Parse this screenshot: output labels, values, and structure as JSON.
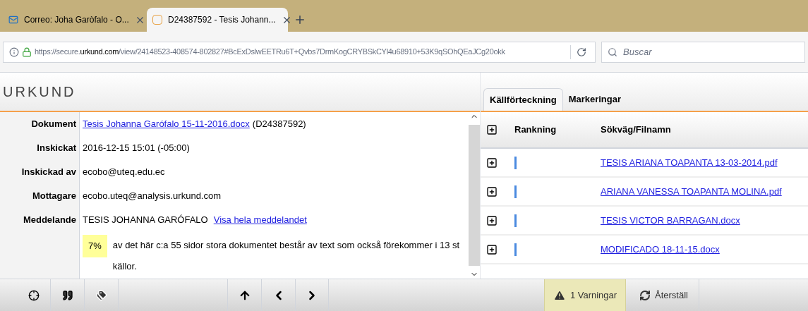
{
  "browser_tabs": [
    {
      "title": "Correo: Joha Garòfalo - O...",
      "selected": false,
      "kind": "mail"
    },
    {
      "title": "D24387592 - Tesis Johann...",
      "selected": true,
      "kind": "urkund"
    }
  ],
  "address_bar": {
    "url_prefix": "https://secure.",
    "url_domain": "urkund.com",
    "url_rest": "/view/24148523-408574-802827#BcExDslwEETRu6T+Qvbs7DrmKogCRYBSkCYl4u68910+53K9qSOhQEaJCg20okk"
  },
  "search": {
    "placeholder": "Buscar"
  },
  "logo": "URKUND",
  "details": [
    {
      "label": "Dokument",
      "link": "Tesis Johanna Garófalo 15-11-2016.docx",
      "value": "(D24387592)"
    },
    {
      "label": "Inskickat",
      "value": "2016-12-15 15:01 (-05:00)"
    },
    {
      "label": "Inskickad av",
      "value": "ecobo@uteq.edu.ec"
    },
    {
      "label": "Mottagare",
      "value": "ecobo.uteq@analysis.urkund.com"
    },
    {
      "label": "Meddelande",
      "value": "TESIS JOHANNA GARÓFALO",
      "link": "Visa hela meddelandet"
    }
  ],
  "summary": {
    "percent": "7%",
    "text": "av det här c:a 55 sidor stora dokumentet består av text som också förekommer i 13 st källor."
  },
  "panel_tabs": [
    {
      "label": "Källförteckning",
      "selected": true
    },
    {
      "label": "Markeringar",
      "selected": false
    }
  ],
  "sources_table": {
    "columns": [
      "Rankning",
      "Sökväg/Filnamn"
    ],
    "rows": [
      {
        "file": "TESIS ARIANA TOAPANTA 13-03-2014.pdf"
      },
      {
        "file": "ARIANA VANESSA TOAPANTA MOLINA.pdf"
      },
      {
        "file": "TESIS VICTOR BARRAGAN.docx"
      },
      {
        "file": "MODIFICADO 18-11-15.docx"
      }
    ]
  },
  "toolbar": {
    "warnings": "1 Varningar",
    "reset": "Återställ"
  }
}
